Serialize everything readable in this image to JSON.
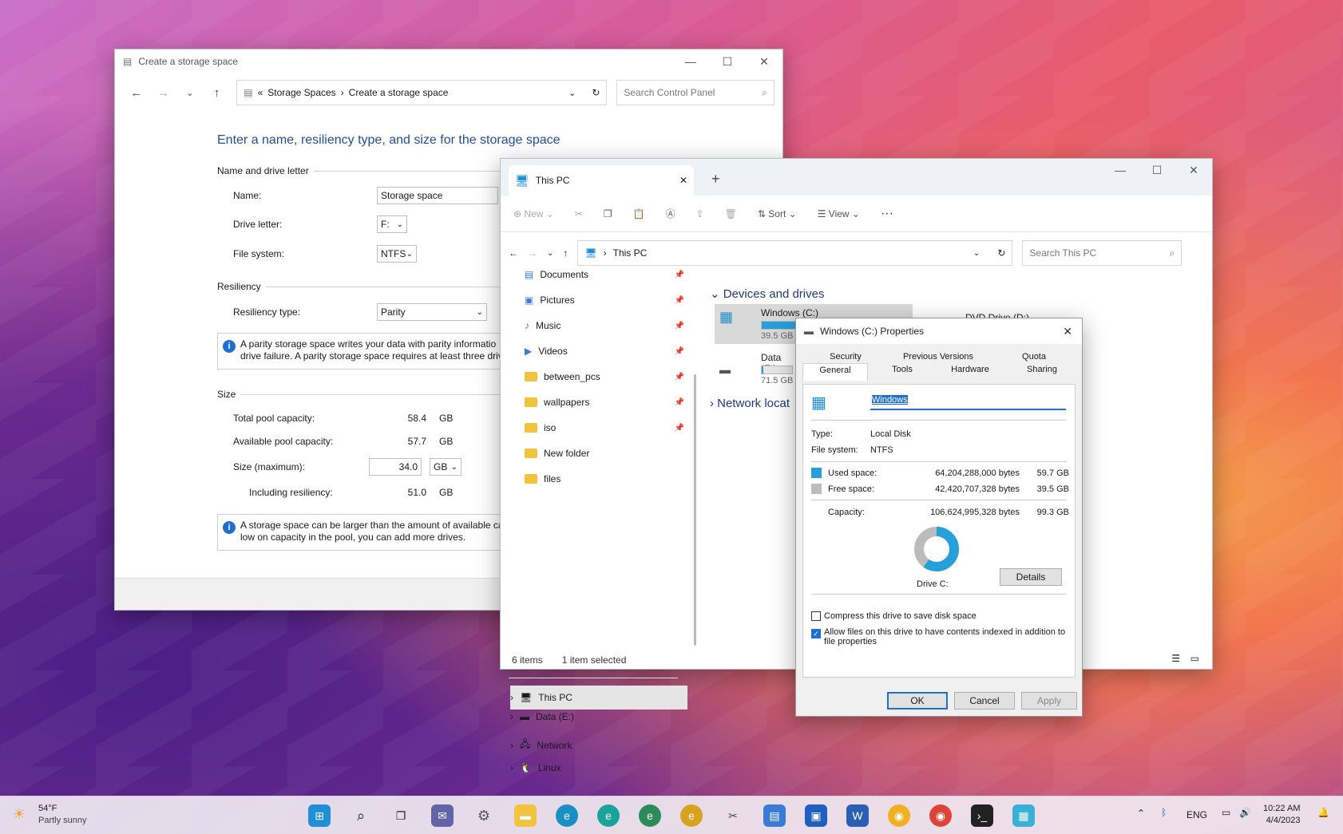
{
  "cp": {
    "title": "Create a storage space",
    "breadcrumb_root": "Storage Spaces",
    "breadcrumb_sep": "›",
    "breadcrumb_current": "Create a storage space",
    "breadcrumb_prefix": "«",
    "search_placeholder": "Search Control Panel",
    "heading": "Enter a name, resiliency type, and size for the storage space",
    "group_name": "Name and drive letter",
    "name_label": "Name:",
    "name_value": "Storage space",
    "drive_label": "Drive letter:",
    "drive_value": "F:",
    "fs_label": "File system:",
    "fs_value": "NTFS",
    "group_res": "Resiliency",
    "res_label": "Resiliency type:",
    "res_value": "Parity",
    "res_info_1": "A parity storage space writes your data with parity informatio",
    "res_info_2": "drive failure. A parity storage space requires at least three driv",
    "group_size": "Size",
    "total_label": "Total pool capacity:",
    "total_value": "58.4",
    "avail_label": "Available pool capacity:",
    "avail_value": "57.7",
    "size_label": "Size (maximum):",
    "size_value": "34.0",
    "incl_label": "Including resiliency:",
    "incl_value": "51.0",
    "unit": "GB",
    "size_info_1": "A storage space can be larger than the amount of available ca",
    "size_info_2": "low on capacity in the pool, you can add more drives."
  },
  "ex": {
    "tab_title": "This PC",
    "new_tab": "+",
    "toolbar_new": "New",
    "toolbar_sort": "Sort",
    "toolbar_view": "View",
    "toolbar_more": "···",
    "address": "This PC",
    "search_placeholder": "Search This PC",
    "side_items": [
      {
        "label": "Documents",
        "pinned": true
      },
      {
        "label": "Pictures",
        "pinned": true
      },
      {
        "label": "Music",
        "pinned": true
      },
      {
        "label": "Videos",
        "pinned": true
      },
      {
        "label": "between_pcs",
        "pinned": true
      },
      {
        "label": "wallpapers",
        "pinned": true
      },
      {
        "label": "iso",
        "pinned": true
      },
      {
        "label": "New folder",
        "pinned": false
      },
      {
        "label": "files",
        "pinned": false
      }
    ],
    "tree": [
      "This PC",
      "Data (E:)",
      "Network",
      "Linux"
    ],
    "section_devices": "Devices and drives",
    "drive_c": "Windows (C:)",
    "drive_c_free": "39.5 GB",
    "drive_c_fill": 0.6,
    "drive_e": "Data (E:)",
    "drive_e_free": "71.5 GB",
    "drive_e_fill": 0.05,
    "dvd": "DVD Drive (D:)",
    "section_network": "Network locat",
    "status_items": "6 items",
    "status_selected": "1 item selected"
  },
  "props": {
    "title": "Windows (C:) Properties",
    "tabs_top": [
      "Security",
      "Previous Versions",
      "Quota"
    ],
    "tabs_bottom": [
      "General",
      "Tools",
      "Hardware",
      "Sharing"
    ],
    "volume_name": "Windows",
    "type_label": "Type:",
    "type_value": "Local Disk",
    "fs_label": "File system:",
    "fs_value": "NTFS",
    "used_label": "Used space:",
    "used_bytes": "64,204,288,000 bytes",
    "used_gb": "59.7 GB",
    "free_label": "Free space:",
    "free_bytes": "42,420,707,328 bytes",
    "free_gb": "39.5 GB",
    "cap_label": "Capacity:",
    "cap_bytes": "106,624,995,328 bytes",
    "cap_gb": "99.3 GB",
    "used_fraction": 0.6,
    "drive_label": "Drive C:",
    "details_btn": "Details",
    "compress_label": "Compress this drive to save disk space",
    "index_label_1": "Allow files on this drive to have contents indexed in addition to",
    "index_label_2": "file properties",
    "ok": "OK",
    "cancel": "Cancel",
    "apply": "Apply",
    "used_color": "#26a0da",
    "free_color": "#bcbcbc"
  },
  "taskbar": {
    "temp": "54°F",
    "weather": "Partly sunny",
    "lang": "ENG",
    "time": "10:22 AM",
    "date": "4/4/2023"
  }
}
